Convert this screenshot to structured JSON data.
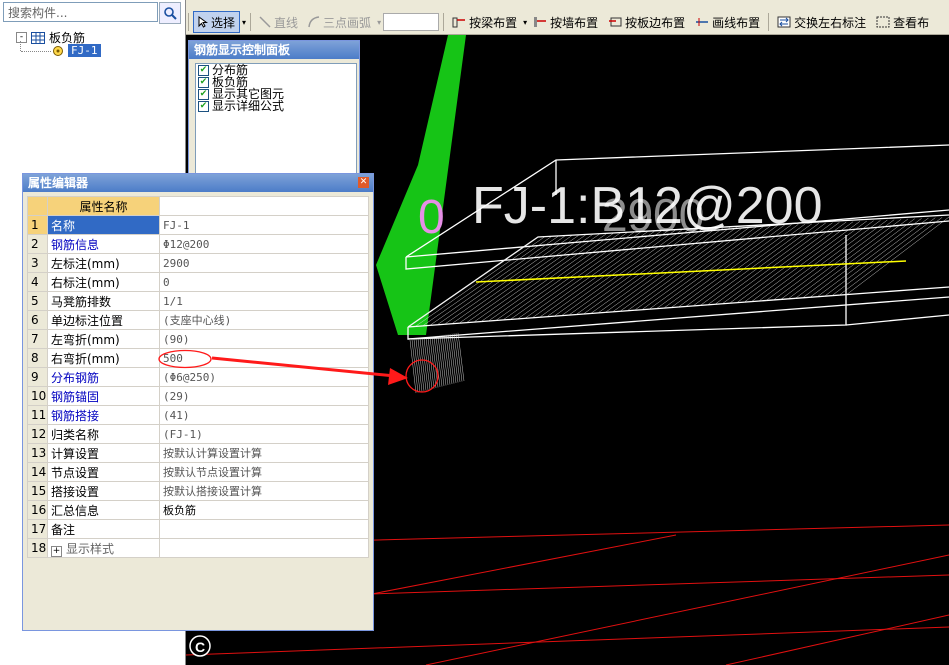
{
  "search": {
    "placeholder": "搜索构件..."
  },
  "tree": {
    "root_label": "板负筋",
    "root_expander": "-",
    "child_label": "FJ-1"
  },
  "toolbar": {
    "items": [
      {
        "label": "选择"
      },
      {
        "label": "直线"
      },
      {
        "label": "三点画弧"
      },
      {
        "label": "按梁布置"
      },
      {
        "label": "按墙布置"
      },
      {
        "label": "按板边布置"
      },
      {
        "label": "画线布置"
      },
      {
        "label": "交换左右标注"
      },
      {
        "label": "查看布"
      }
    ]
  },
  "control_panel": {
    "title": "钢筋显示控制面板",
    "items": [
      {
        "label": "分布筋",
        "checked": true
      },
      {
        "label": "板负筋",
        "checked": true
      },
      {
        "label": "显示其它图元",
        "checked": true
      },
      {
        "label": "显示详细公式",
        "checked": true
      }
    ]
  },
  "property_panel": {
    "title": "属性编辑器",
    "header": "属性名称",
    "rows": [
      {
        "num": "1",
        "name": "名称",
        "value": "FJ-1"
      },
      {
        "num": "2",
        "name": "钢筋信息",
        "value": "Φ12@200"
      },
      {
        "num": "3",
        "name": "左标注(mm)",
        "value": "2900"
      },
      {
        "num": "4",
        "name": "右标注(mm)",
        "value": "0"
      },
      {
        "num": "5",
        "name": "马凳筋排数",
        "value": "1/1"
      },
      {
        "num": "6",
        "name": "单边标注位置",
        "value": "(支座中心线)"
      },
      {
        "num": "7",
        "name": "左弯折(mm)",
        "value": "(90)"
      },
      {
        "num": "8",
        "name": "右弯折(mm)",
        "value": "500"
      },
      {
        "num": "9",
        "name": "分布钢筋",
        "value": "(Φ6@250)"
      },
      {
        "num": "10",
        "name": "钢筋锚固",
        "value": "(29)"
      },
      {
        "num": "11",
        "name": "钢筋搭接",
        "value": "(41)"
      },
      {
        "num": "12",
        "name": "归类名称",
        "value": "(FJ-1)"
      },
      {
        "num": "13",
        "name": "计算设置",
        "value": "按默认计算设置计算"
      },
      {
        "num": "14",
        "name": "节点设置",
        "value": "按默认节点设置计算"
      },
      {
        "num": "15",
        "name": "搭接设置",
        "value": "按默认搭接设置计算"
      },
      {
        "num": "16",
        "name": "汇总信息",
        "value": "板负筋"
      },
      {
        "num": "17",
        "name": "备注",
        "value": ""
      },
      {
        "num": "18",
        "name": "显示样式",
        "value": ""
      }
    ],
    "row18_expander": "+"
  },
  "canvas": {
    "label_zero": "0",
    "label_rebar_a": "FJ-1:B12@200",
    "label_rebar_b": "2900",
    "axis_marker": "C",
    "colors": {
      "background": "#000000",
      "beam": "#16c416",
      "slab_outline": "#ffffff",
      "rebar": "#ffffff",
      "rebar_highlight": "#ffff00",
      "grid": "#e01010",
      "annotation": "#ff1a1a",
      "label_pink": "#e68fe6",
      "label_white": "#ffffff"
    }
  }
}
